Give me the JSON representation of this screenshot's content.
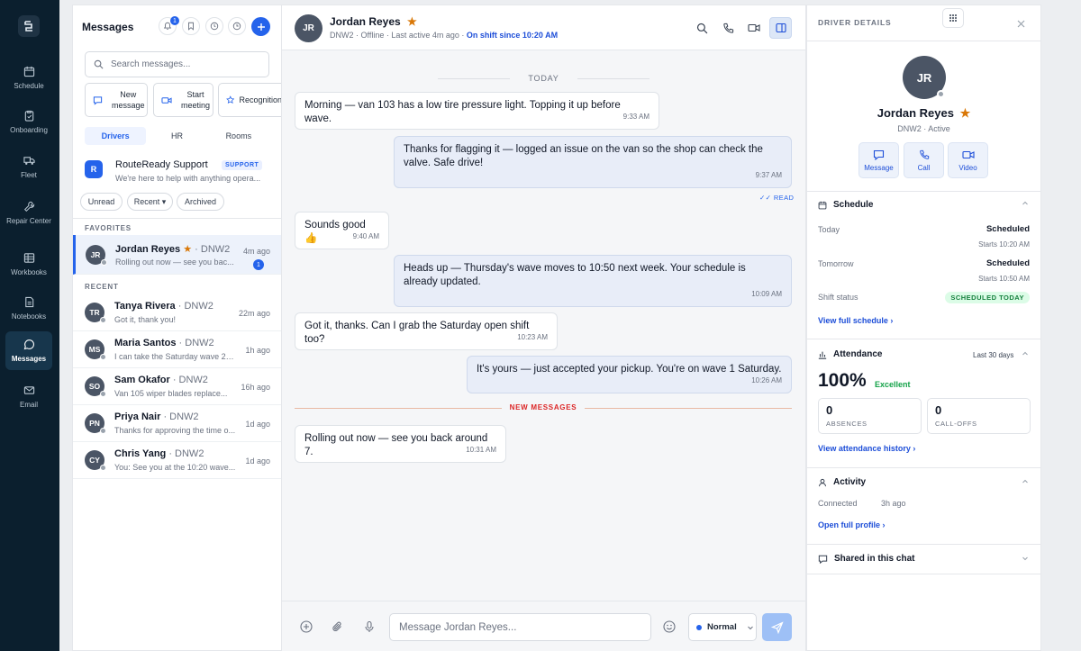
{
  "nav": {
    "items": [
      {
        "label": "Schedule",
        "icon": "calendar-icon"
      },
      {
        "label": "Onboarding",
        "icon": "clipboard-icon"
      },
      {
        "label": "Fleet",
        "icon": "truck-icon"
      },
      {
        "label": "Repair Center",
        "icon": "wrench-icon"
      },
      {
        "label": "Workbooks",
        "icon": "table-icon"
      },
      {
        "label": "Notebooks",
        "icon": "notebook-icon"
      },
      {
        "label": "Messages",
        "icon": "chat-icon"
      },
      {
        "label": "Email",
        "icon": "mail-icon"
      }
    ],
    "active": "Messages"
  },
  "list": {
    "title": "Messages",
    "bell_badge": "1",
    "search_placeholder": "Search messages...",
    "quick_actions": [
      {
        "label1": "New",
        "label2": "message"
      },
      {
        "label1": "Start",
        "label2": "meeting"
      },
      {
        "label1": "Recognition",
        "label2": ""
      }
    ],
    "tabs": [
      "Drivers",
      "HR",
      "Rooms"
    ],
    "active_tab": "Drivers",
    "support": {
      "avatar": "R",
      "name": "RouteReady Support",
      "badge": "SUPPORT",
      "preview": "We're here to help with anything opera..."
    },
    "filters": [
      "Unread",
      "Recent ▾",
      "Archived"
    ],
    "favorites_label": "FAVORITES",
    "recent_label": "RECENT",
    "favorites": [
      {
        "initials": "JR",
        "name": "Jordan Reyes",
        "star": "★",
        "org": "· DNW2",
        "preview": "Rolling out now — see you bac...",
        "time": "4m ago",
        "unread": "1"
      }
    ],
    "recent": [
      {
        "initials": "TR",
        "name": "Tanya Rivera",
        "org": "· DNW2",
        "preview": "Got it, thank you!",
        "time": "22m ago"
      },
      {
        "initials": "MS",
        "name": "Maria Santos",
        "org": "· DNW2",
        "preview": "I can take the Saturday wave 2 i...",
        "time": "1h ago"
      },
      {
        "initials": "SO",
        "name": "Sam Okafor",
        "org": "· DNW2",
        "preview": "Van 105 wiper blades replace...",
        "time": "16h ago"
      },
      {
        "initials": "PN",
        "name": "Priya Nair",
        "org": "· DNW2",
        "preview": "Thanks for approving the time o...",
        "time": "1d ago"
      },
      {
        "initials": "CY",
        "name": "Chris Yang",
        "org": "· DNW2",
        "preview": "You: See you at the 10:20 wave...",
        "time": "1d ago"
      }
    ]
  },
  "chat": {
    "initials": "JR",
    "name": "Jordan Reyes",
    "star": "★",
    "status": "DNW2 · Offline · Last active 4m ago · ",
    "shift": "On shift since 10:20 AM",
    "day_label": "TODAY",
    "messages": [
      {
        "text": "Morning — van 103 has a low tire pressure light. Topping it up before wave.",
        "time": "9:33 AM",
        "dir": "in"
      },
      {
        "text": "Thanks for flagging it — logged an issue on the van so the shop can check the valve. Safe drive!",
        "time": "9:37 AM",
        "dir": "out"
      },
      {
        "text": "Sounds good 👍",
        "time": "9:40 AM",
        "dir": "in"
      },
      {
        "text": "Heads up — Thursday's wave moves to 10:50 next week. Your schedule is already updated.",
        "time": "10:09 AM",
        "dir": "out"
      },
      {
        "text": "Got it, thanks. Can I grab the Saturday open shift too?",
        "time": "10:23 AM",
        "dir": "in"
      },
      {
        "text": "It's yours — just accepted your pickup. You're on wave 1 Saturday.",
        "time": "10:26 AM",
        "dir": "out"
      },
      {
        "text": "Rolling out now — see you back around 7.",
        "time": "10:31 AM",
        "dir": "in"
      }
    ],
    "read_label": "✓✓ READ",
    "new_messages_label": "NEW MESSAGES",
    "composer_placeholder": "Message Jordan Reyes...",
    "priority": "Normal"
  },
  "details": {
    "title": "DRIVER DETAILS",
    "initials": "JR",
    "name": "Jordan Reyes",
    "star": "★",
    "subtitle": "DNW2 · Active",
    "actions": [
      "Message",
      "Call",
      "Video"
    ],
    "schedule": {
      "title": "Schedule",
      "today_label": "Today",
      "today_value": "Scheduled",
      "today_sub": "Starts 10:20 AM",
      "tomorrow_label": "Tomorrow",
      "tomorrow_value": "Scheduled",
      "tomorrow_sub": "Starts 10:50 AM",
      "status_label": "Shift status",
      "status_badge": "SCHEDULED TODAY",
      "link": "View full schedule ›"
    },
    "attendance": {
      "title": "Attendance",
      "range": "Last 30 days",
      "percent": "100%",
      "rating": "Excellent",
      "absences": "0",
      "absences_label": "ABSENCES",
      "calloffs": "0",
      "calloffs_label": "CALL-OFFS",
      "link": "View attendance history ›"
    },
    "activity": {
      "title": "Activity",
      "label": "Connected",
      "value": "3h ago",
      "link": "Open full profile ›"
    },
    "shared": {
      "title": "Shared in this chat"
    }
  },
  "colors": {
    "accent": "#2563eb",
    "nav_bg": "#0b1f2e",
    "star": "#d97706",
    "danger": "#dc2626",
    "success": "#16a34a"
  }
}
